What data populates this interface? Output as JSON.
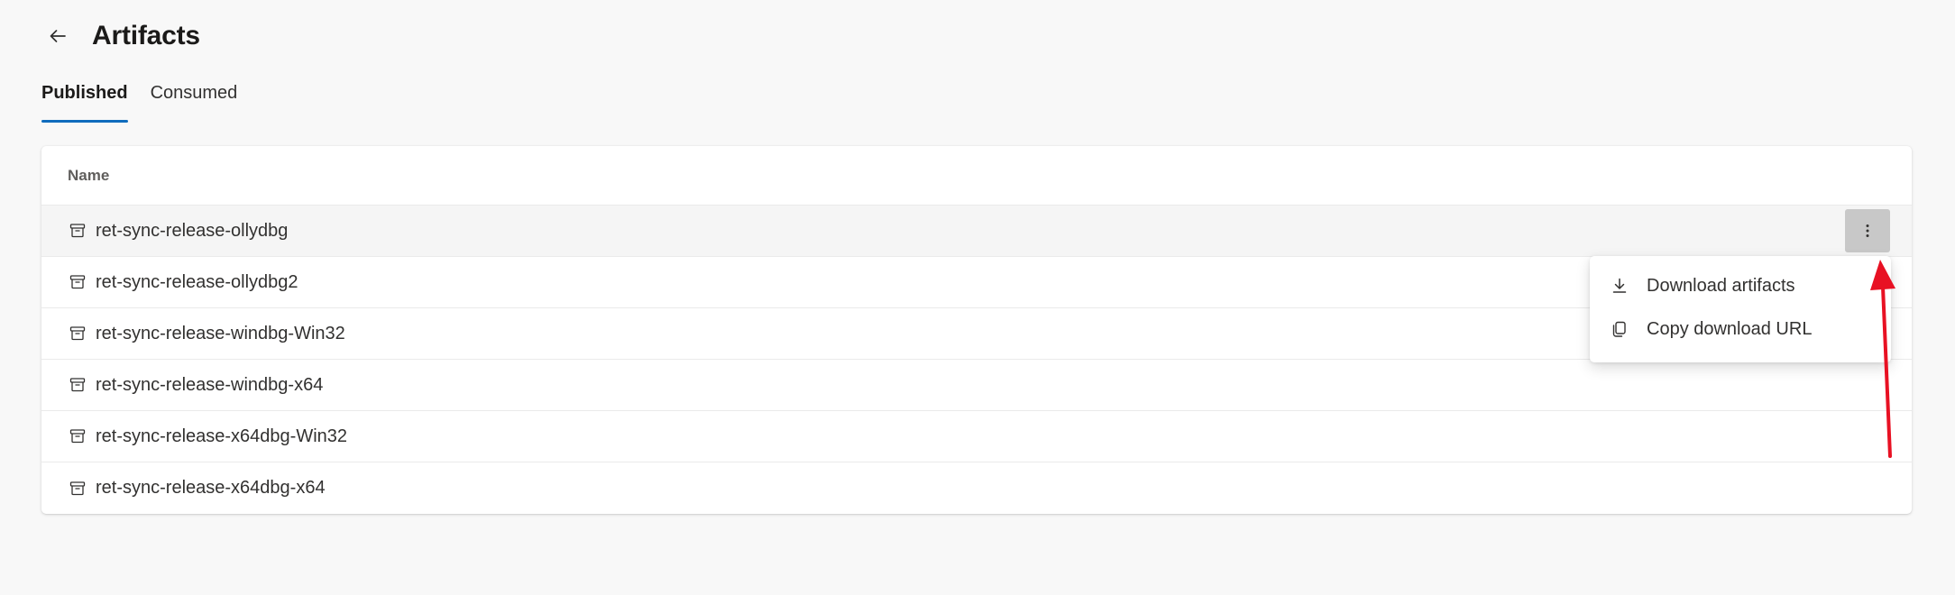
{
  "header": {
    "back_label": "Back",
    "title": "Artifacts"
  },
  "tabs": [
    {
      "label": "Published",
      "selected": true
    },
    {
      "label": "Consumed",
      "selected": false
    }
  ],
  "table": {
    "column_header": "Name",
    "rows": [
      {
        "name": "ret-sync-release-ollydbg",
        "icon": "artifact-box-icon"
      },
      {
        "name": "ret-sync-release-ollydbg2",
        "icon": "artifact-box-icon"
      },
      {
        "name": "ret-sync-release-windbg-Win32",
        "icon": "artifact-box-icon"
      },
      {
        "name": "ret-sync-release-windbg-x64",
        "icon": "artifact-box-icon"
      },
      {
        "name": "ret-sync-release-x64dbg-Win32",
        "icon": "artifact-box-icon"
      },
      {
        "name": "ret-sync-release-x64dbg-x64",
        "icon": "artifact-box-icon"
      }
    ]
  },
  "context_menu": {
    "items": [
      {
        "label": "Download artifacts",
        "icon": "download-icon"
      },
      {
        "label": "Copy download URL",
        "icon": "copy-icon"
      }
    ]
  },
  "colors": {
    "accent": "#0f6cbd",
    "annotation_arrow": "#e81123",
    "background": "#f8f8f8"
  }
}
